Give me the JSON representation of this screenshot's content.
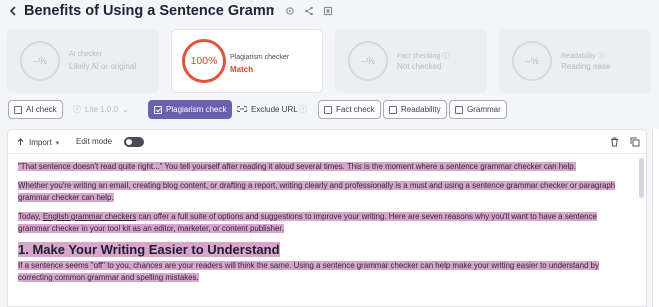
{
  "header": {
    "title": "Benefits of Using a Sentence Grammar Chec...",
    "back_icon": "chevron-left-icon",
    "icons": [
      "gear-icon",
      "share-icon",
      "copy-icon"
    ]
  },
  "cards": [
    {
      "ring": "--%",
      "label": "AI checker",
      "value": "Likely AI or original"
    },
    {
      "ring": "100%",
      "label": "Plagiarism checker",
      "value": "Match"
    },
    {
      "ring": "--%",
      "label": "Fact checking ⓘ",
      "value": "Not checked"
    },
    {
      "ring": "--%",
      "label": "Readability ⓘ",
      "value": "Reading ease"
    }
  ],
  "toolbar": {
    "ai_check": "AI check",
    "lite": "Lite 1.0.0",
    "lite_arrow": "⌄",
    "plagiarism_check": "Plagiarism check",
    "exclude_url": "Exclude URL",
    "info": "ⓘ",
    "fact_check": "Fact check",
    "readability": "Readability",
    "grammar": "Grammar"
  },
  "editor": {
    "import": "Import",
    "import_arrow": "▾",
    "edit_mode": "Edit mode",
    "edit_mode_on": false
  },
  "document": {
    "p1": "\"That sentence doesn't read quite right...\" You tell yourself after reading it aloud several times.   This is the moment where a sentence  grammar checker can help.",
    "p2": "Whether you're writing an email, creating blog content, or drafting a report, writing clearly and professionally is a must and using a sentence grammar checker or paragraph grammar checker can help.",
    "p3a": "Today,  ",
    "p3_link": "English grammar checkers",
    "p3b": "  can offer a full suite of options and suggestions to improve your writing.   Here are seven reasons why you'll want to have a sentence grammar checker in your tool kit as an editor, marketer, or content publisher.",
    "h1": "1.   Make Your Writing Easier to Understand",
    "p4": "If a sentence seems \"off\" to you, chances are your readers will think the same.   Using a sentence grammar checker can help make your writing easier to understand by correcting common grammar and spelling mistakes."
  },
  "colors": {
    "accent": "#6b5fb0",
    "match": "#d8442c",
    "highlight": "#d8a6cc"
  }
}
